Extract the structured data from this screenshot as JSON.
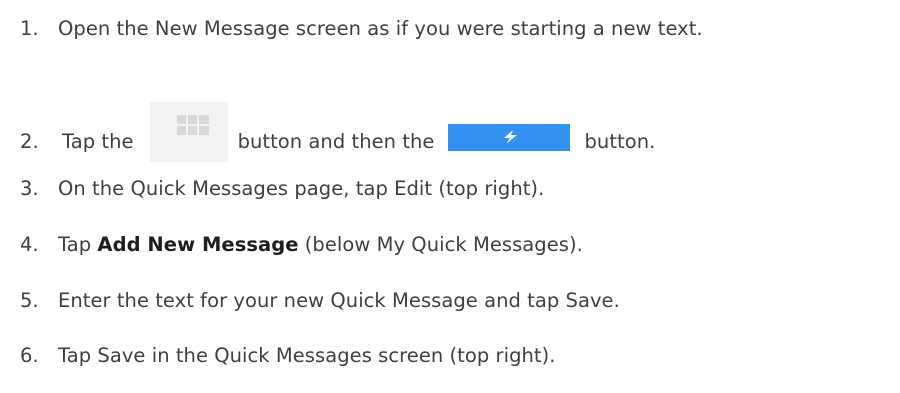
{
  "steps": [
    {
      "num": "1.",
      "text": "Open the New Message screen as if you were starting a new text."
    },
    {
      "num": "2.",
      "text_before": "Tap the",
      "text_middle": "button and then the",
      "text_after": "button."
    },
    {
      "num": "3.",
      "text": "On the Quick Messages page, tap Edit (top right)."
    },
    {
      "num": "4.",
      "text_before": "Tap",
      "bold": "Add New Message",
      "text_after": "(below My Quick Messages)."
    },
    {
      "num": "5.",
      "text": "Enter the text for your new Quick Message and tap Save."
    },
    {
      "num": "6.",
      "text": "Tap Save in the Quick Messages screen (top right)."
    }
  ],
  "icons": {
    "grid_button": "apps-grid-icon",
    "quick_button": "lightning-bolt-icon",
    "quick_button_color": "#3391ef",
    "grid_button_bg": "#f3f3f3",
    "grid_cell_color": "#d8d8d8"
  },
  "colors": {
    "text": "#404040",
    "bold_text": "#1f1f1f",
    "background": "#ffffff"
  }
}
